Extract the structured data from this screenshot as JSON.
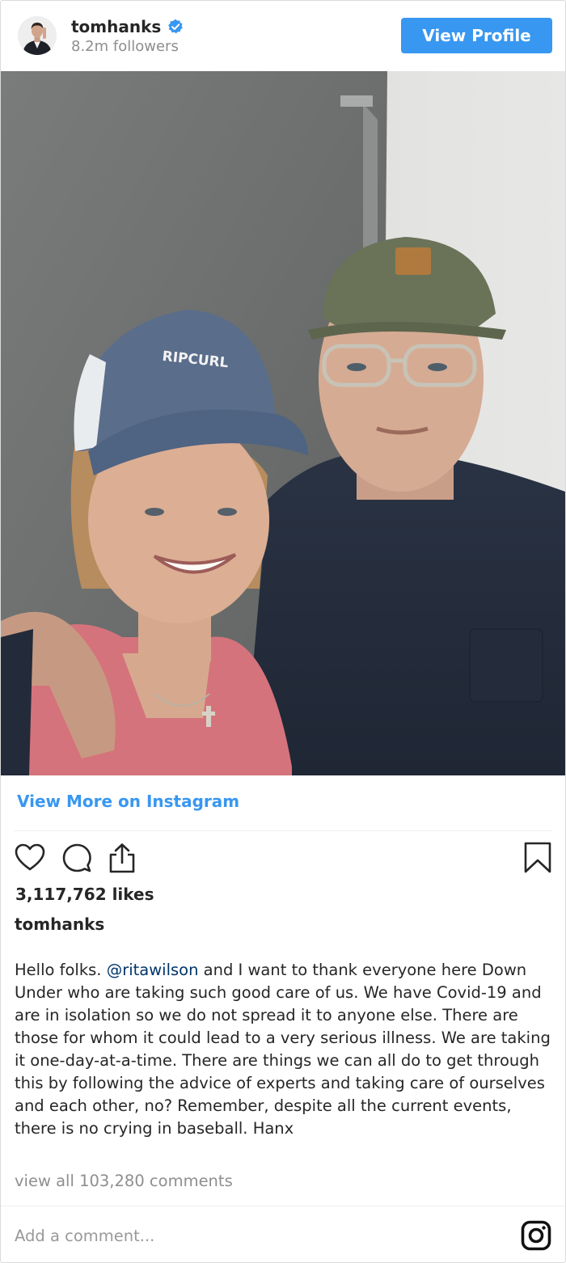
{
  "header": {
    "username": "tomhanks",
    "followers": "8.2m followers",
    "view_profile_label": "View Profile"
  },
  "post": {
    "cap_text": "RIPCURL",
    "view_more_label": "View More on Instagram",
    "likes": "3,117,762 likes",
    "caption_user": "tomhanks",
    "caption_before": "Hello folks. ",
    "caption_mention": "@ritawilson",
    "caption_after": " and I want to thank everyone here Down Under who are taking such good care of us. We have Covid-19 and are in isolation so we do not spread it to anyone else. There are those for whom it could lead to a very serious illness. We are taking it one-day-at-a-time. There are things we can all do to get through this by following the advice of experts and taking care of ourselves and each other, no? Remember, despite all the current events, there is no crying in baseball. Hanx",
    "view_comments": "view all 103,280 comments"
  },
  "comment": {
    "placeholder": "Add a comment..."
  },
  "icons": {
    "verified": "verified-badge-icon",
    "like": "heart-icon",
    "comment": "speech-bubble-icon",
    "share": "share-icon",
    "save": "bookmark-icon",
    "instagram": "instagram-logo-icon"
  },
  "colors": {
    "accent": "#3897f0",
    "mention": "#003569",
    "muted": "#8e8e8e"
  }
}
